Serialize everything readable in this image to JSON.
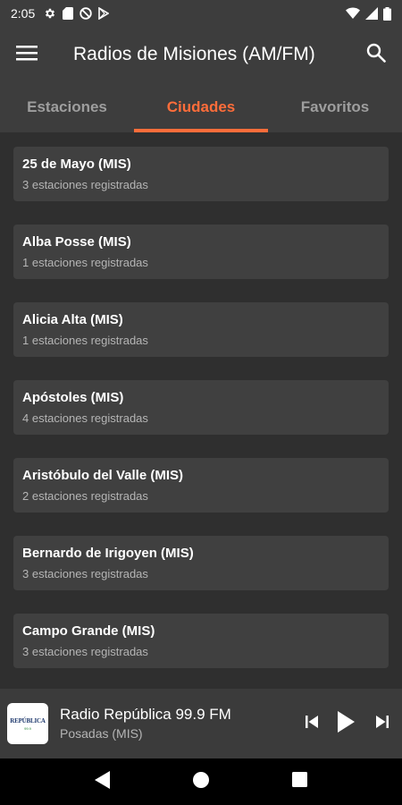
{
  "status_bar": {
    "time": "2:05",
    "icons": [
      "gear-icon",
      "sd-card-icon",
      "no-sync-icon",
      "play-store-icon"
    ],
    "right_icons": [
      "wifi-icon",
      "signal-icon",
      "battery-icon"
    ]
  },
  "app_bar": {
    "title": "Radios de Misiones (AM/FM)",
    "menu_icon": "menu-icon",
    "search_icon": "search-icon"
  },
  "tabs": [
    {
      "label": "Estaciones",
      "active": false
    },
    {
      "label": "Ciudades",
      "active": true
    },
    {
      "label": "Favoritos",
      "active": false
    }
  ],
  "colors": {
    "accent": "#ff6d3a",
    "background": "#2f2f2f",
    "bar": "#3d3d3d",
    "card": "#404040"
  },
  "cities": [
    {
      "name": "25 de Mayo (MIS)",
      "count": "3 estaciones registradas"
    },
    {
      "name": "Alba Posse (MIS)",
      "count": "1 estaciones registradas"
    },
    {
      "name": "Alicia Alta (MIS)",
      "count": "1 estaciones registradas"
    },
    {
      "name": "Apóstoles (MIS)",
      "count": "4 estaciones registradas"
    },
    {
      "name": "Aristóbulo del Valle (MIS)",
      "count": "2 estaciones registradas"
    },
    {
      "name": "Bernardo de Irigoyen (MIS)",
      "count": "3 estaciones registradas"
    },
    {
      "name": "Campo Grande (MIS)",
      "count": "3 estaciones registradas"
    }
  ],
  "player": {
    "station": "Radio República 99.9 FM",
    "city": "Posadas (MIS)",
    "logo_top": "REPÚBLICA",
    "logo_bottom": "99.9"
  },
  "nav_bar": {
    "icons": [
      "back-icon",
      "home-icon",
      "recents-icon"
    ]
  }
}
